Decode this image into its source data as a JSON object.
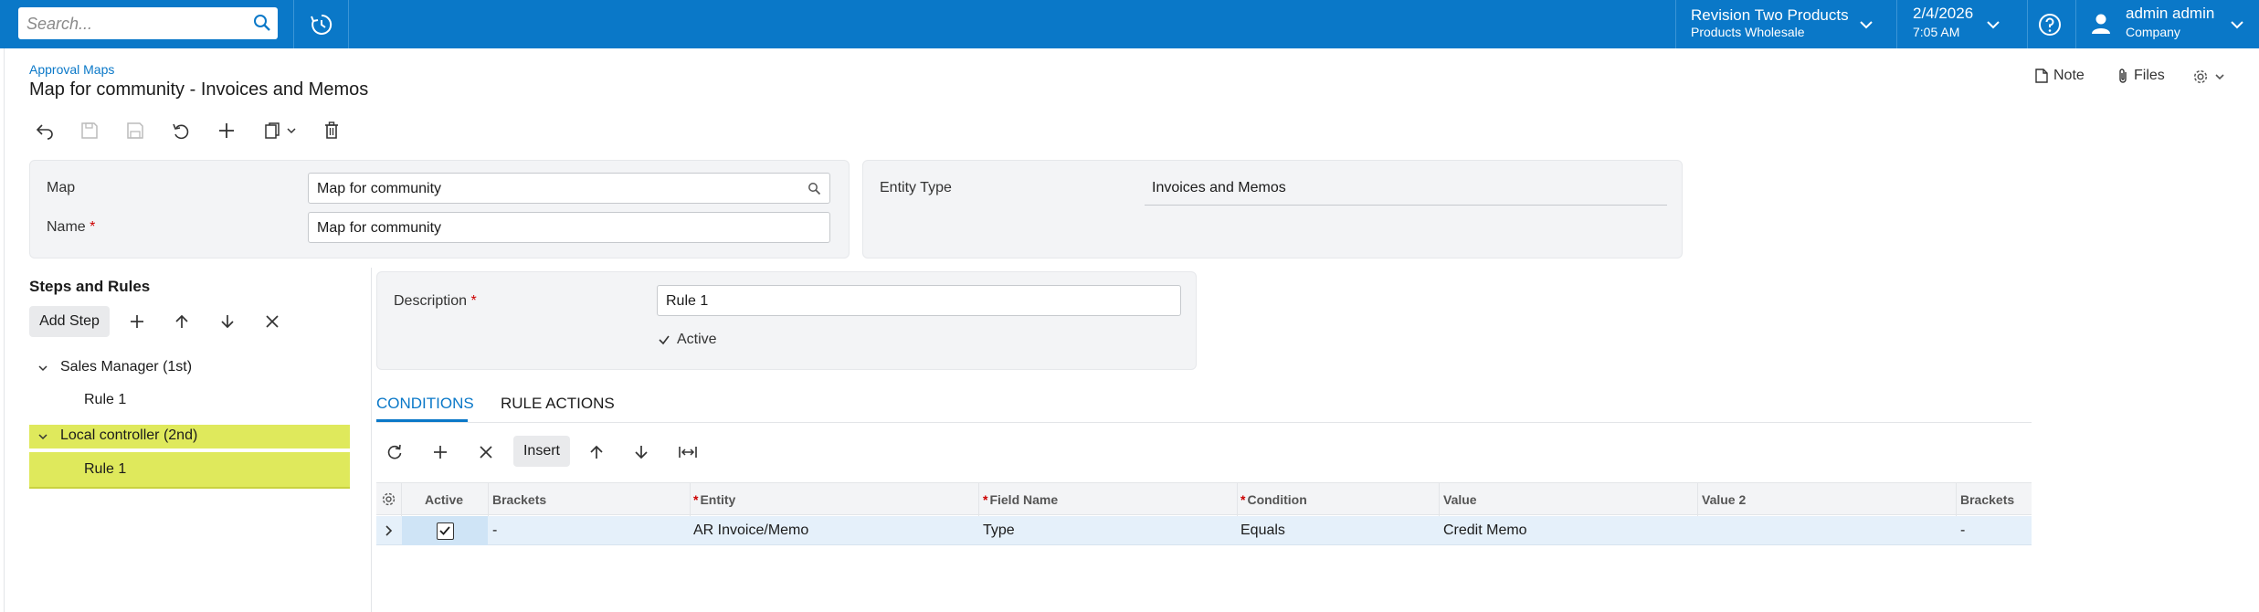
{
  "topbar": {
    "search_placeholder": "Search...",
    "company_name": "Revision Two Products",
    "company_sub": "Products Wholesale",
    "date": "2/4/2026",
    "time": "7:05 AM",
    "user_name": "admin admin",
    "user_sub": "Company"
  },
  "header": {
    "breadcrumb": "Approval Maps",
    "title": "Map for community - Invoices and Memos",
    "note_label": "Note",
    "files_label": "Files"
  },
  "form": {
    "map_label": "Map",
    "map_value": "Map for community",
    "name_label": "Name",
    "name_value": "Map for community",
    "entity_type_label": "Entity Type",
    "entity_type_value": "Invoices and Memos"
  },
  "tree": {
    "title": "Steps and Rules",
    "add_step_label": "Add Step",
    "steps": [
      {
        "label": "Sales Manager (1st)",
        "rules": [
          "Rule 1"
        ]
      },
      {
        "label": "Local controller (2nd)",
        "rules": [
          "Rule 1"
        ]
      }
    ]
  },
  "rule": {
    "description_label": "Description",
    "description_value": "Rule 1",
    "active_label": "Active"
  },
  "tabs": [
    {
      "label": "CONDITIONS",
      "active": true
    },
    {
      "label": "RULE ACTIONS",
      "active": false
    }
  ],
  "grid_toolbar": {
    "insert_label": "Insert"
  },
  "grid": {
    "headers": [
      "Active",
      "Brackets",
      "Entity",
      "Field Name",
      "Condition",
      "Value",
      "Value 2",
      "Brackets"
    ],
    "rows": [
      {
        "active": true,
        "brackets": "-",
        "entity": "AR Invoice/Memo",
        "field_name": "Type",
        "condition": "Equals",
        "value": "Credit Memo",
        "value2": "",
        "brackets2": "-"
      }
    ]
  },
  "colors": {
    "accent": "#0a78c8",
    "highlight": "#dfe95c",
    "row_selected": "#e5f0fa"
  }
}
